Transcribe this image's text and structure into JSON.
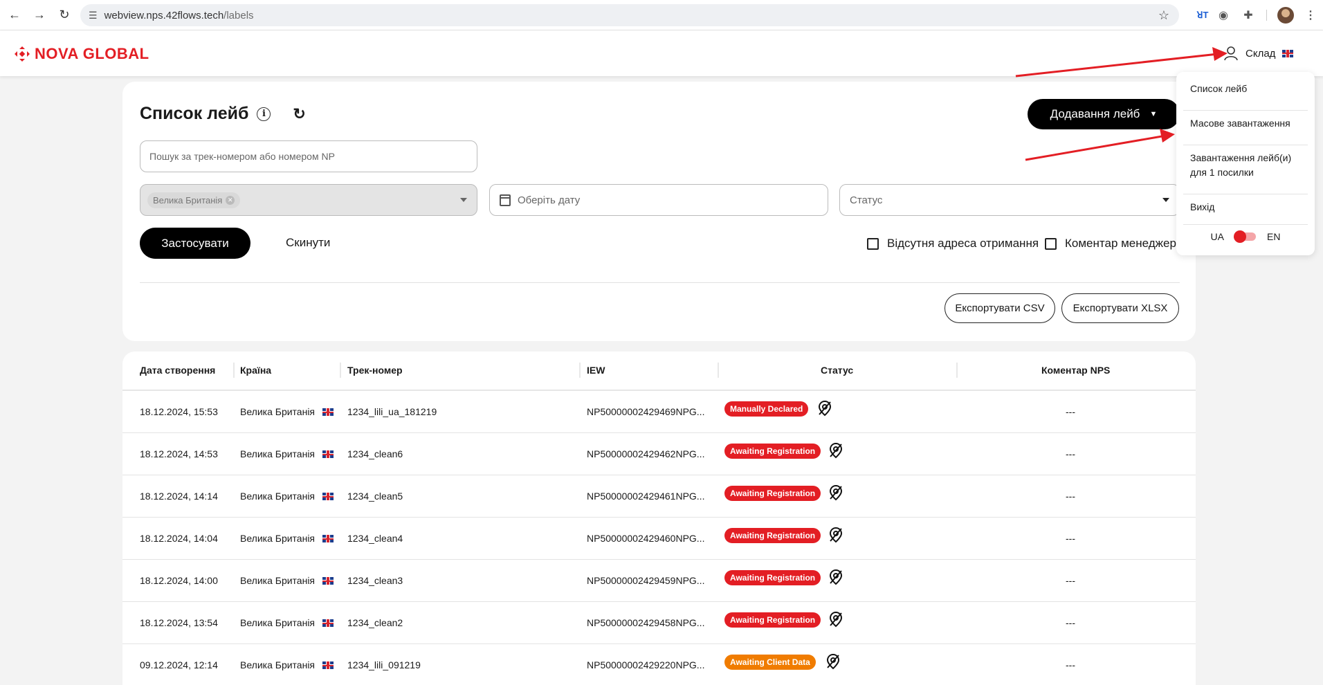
{
  "browser": {
    "url_host": "webview.nps.42flows.tech",
    "url_path": "/labels"
  },
  "header": {
    "brand": "NOVA GLOBAL",
    "user_label": "Склад"
  },
  "filters": {
    "page_title": "Список лейб",
    "add_button": "Додавання лейб",
    "search_placeholder": "Пошук за трек-номером або номером NP",
    "country_chip": "Велика Британія",
    "date_placeholder": "Оберіть дату",
    "status_placeholder": "Статус",
    "apply_button": "Застосувати",
    "reset_button": "Скинути",
    "checkbox_missing_address": "Відсутня адреса отримання",
    "checkbox_manager_comment": "Коментар менеджера",
    "export_csv": "Експортувати CSV",
    "export_xlsx": "Експортувати XLSX"
  },
  "table": {
    "columns": [
      "Дата створення",
      "Країна",
      "Трек-номер",
      "IEW",
      "Статус",
      "Коментар NPS"
    ],
    "rows": [
      {
        "date": "18.12.2024, 15:53",
        "country": "Велика Британія",
        "track": "1234_lili_ua_181219",
        "iew": "NP50000002429469NPG...",
        "status": "Manually Declared",
        "status_color": "#e31e24",
        "comment": "---"
      },
      {
        "date": "18.12.2024, 14:53",
        "country": "Велика Британія",
        "track": "1234_clean6",
        "iew": "NP50000002429462NPG...",
        "status": "Awaiting Registration",
        "status_color": "#e31e24",
        "comment": "---"
      },
      {
        "date": "18.12.2024, 14:14",
        "country": "Велика Британія",
        "track": "1234_clean5",
        "iew": "NP50000002429461NPG...",
        "status": "Awaiting Registration",
        "status_color": "#e31e24",
        "comment": "---"
      },
      {
        "date": "18.12.2024, 14:04",
        "country": "Велика Британія",
        "track": "1234_clean4",
        "iew": "NP50000002429460NPG...",
        "status": "Awaiting Registration",
        "status_color": "#e31e24",
        "comment": "---"
      },
      {
        "date": "18.12.2024, 14:00",
        "country": "Велика Британія",
        "track": "1234_clean3",
        "iew": "NP50000002429459NPG...",
        "status": "Awaiting Registration",
        "status_color": "#e31e24",
        "comment": "---"
      },
      {
        "date": "18.12.2024, 13:54",
        "country": "Велика Британія",
        "track": "1234_clean2",
        "iew": "NP50000002429458NPG...",
        "status": "Awaiting Registration",
        "status_color": "#e31e24",
        "comment": "---"
      },
      {
        "date": "09.12.2024, 12:14",
        "country": "Велика Британія",
        "track": "1234_lili_091219",
        "iew": "NP50000002429220NPG...",
        "status": "Awaiting Client Data",
        "status_color": "#f07c00",
        "comment": "---"
      }
    ]
  },
  "menu": {
    "items": [
      "Список лейб",
      "Масове завантаження",
      "Завантаження лейб(и) для 1 посилки",
      "Вихід"
    ],
    "lang_ua": "UA",
    "lang_en": "EN"
  },
  "colors": {
    "brand": "#e31e24",
    "warning": "#f07c00"
  }
}
